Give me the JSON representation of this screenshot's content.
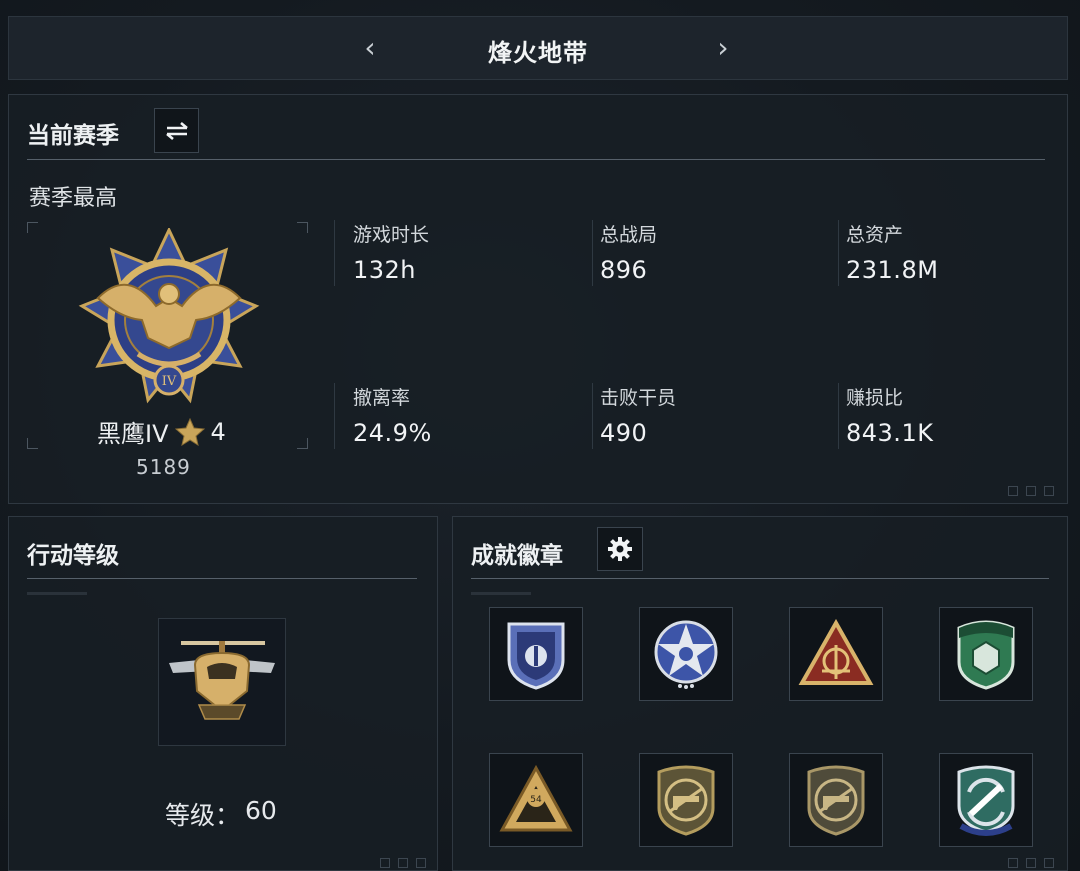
{
  "header": {
    "title": "烽火地带",
    "prev_icon": "chevron-left-icon",
    "next_icon": "chevron-right-icon"
  },
  "season": {
    "title": "当前赛季",
    "switch_icon": "swap-arrows-icon",
    "subtitle": "赛季最高",
    "rank_name": "黑鹰IV",
    "rank_stars": "4",
    "rank_points": "5189",
    "stats": [
      {
        "label": "游戏时长",
        "value": "132h"
      },
      {
        "label": "总战局",
        "value": "896"
      },
      {
        "label": "总资产",
        "value": "231.8M"
      },
      {
        "label": "撤离率",
        "value": "24.9%"
      },
      {
        "label": "击败干员",
        "value": "490"
      },
      {
        "label": "赚损比",
        "value": "843.1K"
      }
    ]
  },
  "level": {
    "title": "行动等级",
    "label": "等级：",
    "value": "60"
  },
  "achievements": {
    "title": "成就徽章",
    "settings_icon": "gear-icon",
    "badges": [
      "shield-badge-icon",
      "star-emblem-badge-icon",
      "compass-triangle-badge-icon",
      "gem-shield-badge-icon",
      "triangle-54-badge-icon",
      "rifle-badge-icon",
      "rifle-badge-icon",
      "missile-shield-badge-icon"
    ]
  },
  "colors": {
    "accent_gold": "#c9a55a",
    "accent_blue": "#3a4f9a",
    "panel_bg": "#181e25"
  }
}
